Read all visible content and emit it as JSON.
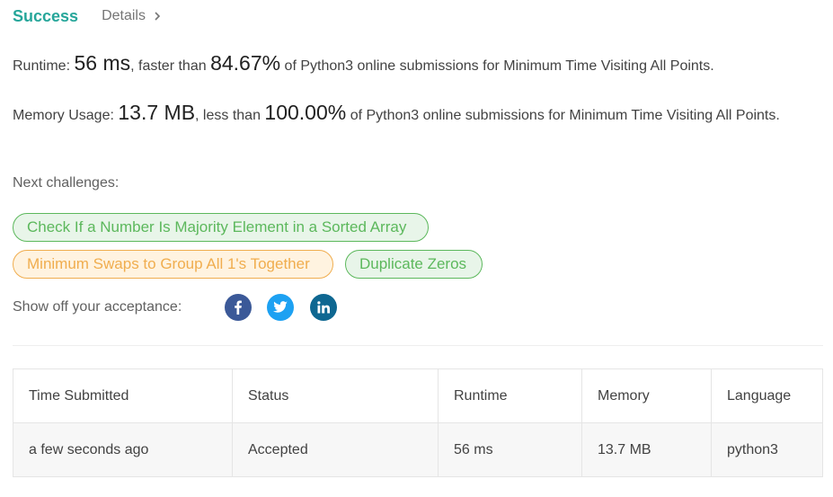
{
  "header": {
    "status": "Success",
    "details_label": "Details",
    "details_icon": "chevron-right-icon"
  },
  "runtime": {
    "label": "Runtime:",
    "value": "56 ms",
    "comparison_prefix": ", faster than",
    "percent": "84.67%",
    "suffix": "of Python3 online submissions for Minimum Time Visiting All Points."
  },
  "memory": {
    "label": "Memory Usage:",
    "value": "13.7 MB",
    "comparison_prefix": ", less than",
    "percent": "100.00%",
    "suffix": "of Python3 online submissions for Minimum Time Visiting All Points."
  },
  "next_challenges": {
    "label": "Next challenges:",
    "items": [
      {
        "title": "Check If a Number Is Majority Element in a Sorted Array",
        "difficulty_color": "#5cb85c"
      },
      {
        "title": "Minimum Swaps to Group All 1's Together",
        "difficulty_color": "#f0ad4e"
      },
      {
        "title": "Duplicate Zeros",
        "difficulty_color": "#5cb85c"
      }
    ]
  },
  "share": {
    "label": "Show off your acceptance:",
    "icons": [
      "facebook-icon",
      "twitter-icon",
      "linkedin-icon"
    ]
  },
  "submissions_table": {
    "columns": [
      "Time Submitted",
      "Status",
      "Runtime",
      "Memory",
      "Language"
    ],
    "rows": [
      [
        "a few seconds ago",
        "Accepted",
        "56 ms",
        "13.7 MB",
        "python3"
      ]
    ]
  },
  "colors": {
    "accent": "#26a69a",
    "easy": "#5cb85c",
    "medium": "#f0ad4e",
    "facebook": "#3b5998",
    "twitter": "#1da1f2",
    "linkedin": "#0e6791"
  }
}
